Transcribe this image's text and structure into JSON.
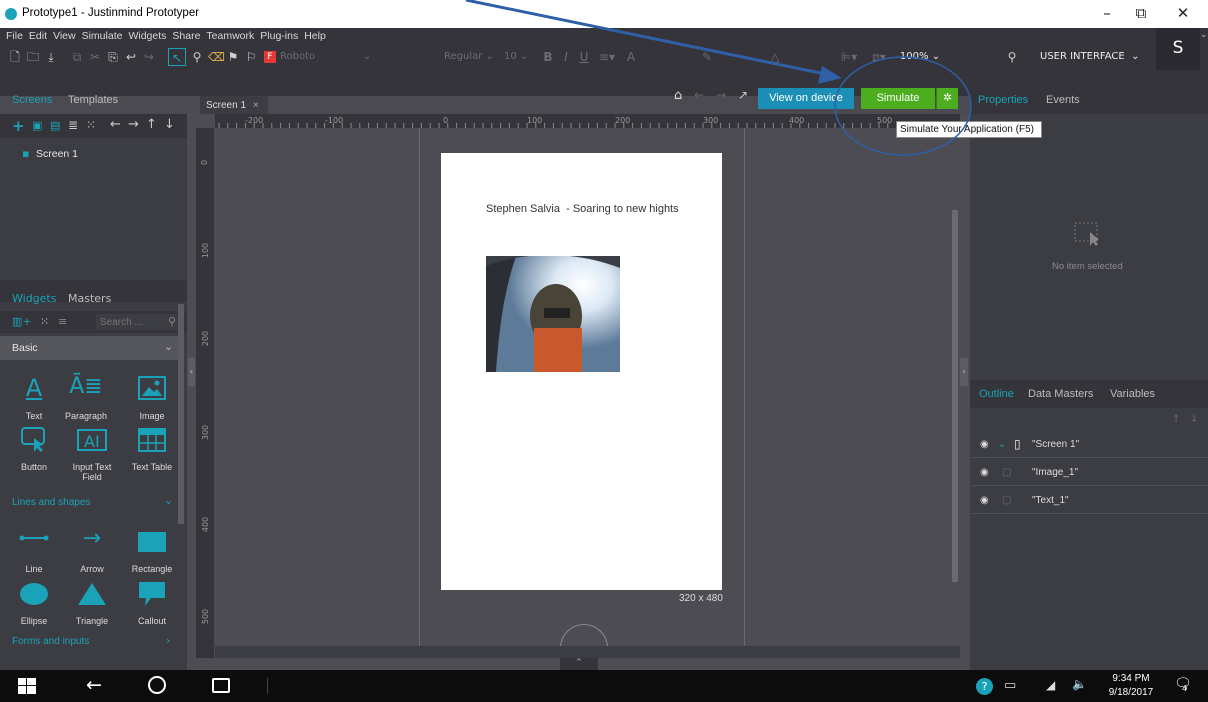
{
  "window": {
    "title": "Prototype1 - Justinmind Prototyper",
    "controls": {
      "minimize": "–",
      "maximize": "⧉",
      "close": "✕"
    }
  },
  "menu": [
    "File",
    "Edit",
    "View",
    "Simulate",
    "Widgets",
    "Share",
    "Teamwork",
    "Plug-ins",
    "Help"
  ],
  "toolbar": {
    "font_name": "Roboto",
    "font_weight": "Regular",
    "font_size": "10",
    "zoom": "100%",
    "perspective": "USER INTERFACE",
    "user_initial": "S"
  },
  "left_tabs": {
    "screens": "Screens",
    "templates": "Templates",
    "widgets": "Widgets",
    "masters": "Masters"
  },
  "screens": [
    {
      "name": "Screen 1"
    }
  ],
  "widget_search": {
    "placeholder": "Search ..."
  },
  "widget_category": "Basic",
  "widgets_basic": [
    {
      "label": "Text",
      "icon": "text-icon"
    },
    {
      "label": "Paragraph",
      "icon": "paragraph-icon"
    },
    {
      "label": "Image",
      "icon": "image-icon"
    },
    {
      "label": "Button",
      "icon": "button-icon"
    },
    {
      "label": "Input Text Field",
      "icon": "input-text-icon"
    },
    {
      "label": "Text Table",
      "icon": "table-icon"
    }
  ],
  "lines_shapes_header": "Lines and shapes",
  "widgets_shapes": [
    {
      "label": "Line",
      "icon": "line-icon"
    },
    {
      "label": "Arrow",
      "icon": "arrow-icon"
    },
    {
      "label": "Rectangle",
      "icon": "rectangle-icon"
    },
    {
      "label": "Ellipse",
      "icon": "ellipse-icon"
    },
    {
      "label": "Triangle",
      "icon": "triangle-icon"
    },
    {
      "label": "Callout",
      "icon": "callout-icon"
    }
  ],
  "forms_header": "Forms and inputs",
  "canvas": {
    "tab": "Screen 1",
    "view_on_device": "View on device",
    "simulate": "Simulate",
    "tooltip": "Simulate Your Application (F5)",
    "ruler_h": [
      "-200",
      "-100",
      "0",
      "100",
      "200",
      "300",
      "400",
      "500"
    ],
    "ruler_v": [
      "0",
      "100",
      "200",
      "300",
      "400",
      "500"
    ],
    "page_text": "Stephen Salvia  - Soaring to new hights",
    "page_size": "320 x 480"
  },
  "right_tabs": {
    "properties": "Properties",
    "events": "Events"
  },
  "properties_empty": "No item selected",
  "outline_tabs": {
    "outline": "Outline",
    "data_masters": "Data Masters",
    "variables": "Variables"
  },
  "outline": [
    {
      "name": "\"Screen 1\"",
      "icon": "phone-icon"
    },
    {
      "name": "\"Image_1\"",
      "icon": "image-icon"
    },
    {
      "name": "\"Text_1\"",
      "icon": "text-icon"
    }
  ],
  "taskbar": {
    "time": "9:34 PM",
    "date": "9/18/2017",
    "notifications": "4"
  },
  "colors": {
    "accent": "#1aa3b8",
    "simulate_green": "#4cae1f",
    "view_device_blue": "#1b8fb5",
    "annotation_blue": "#2f5fa6"
  }
}
